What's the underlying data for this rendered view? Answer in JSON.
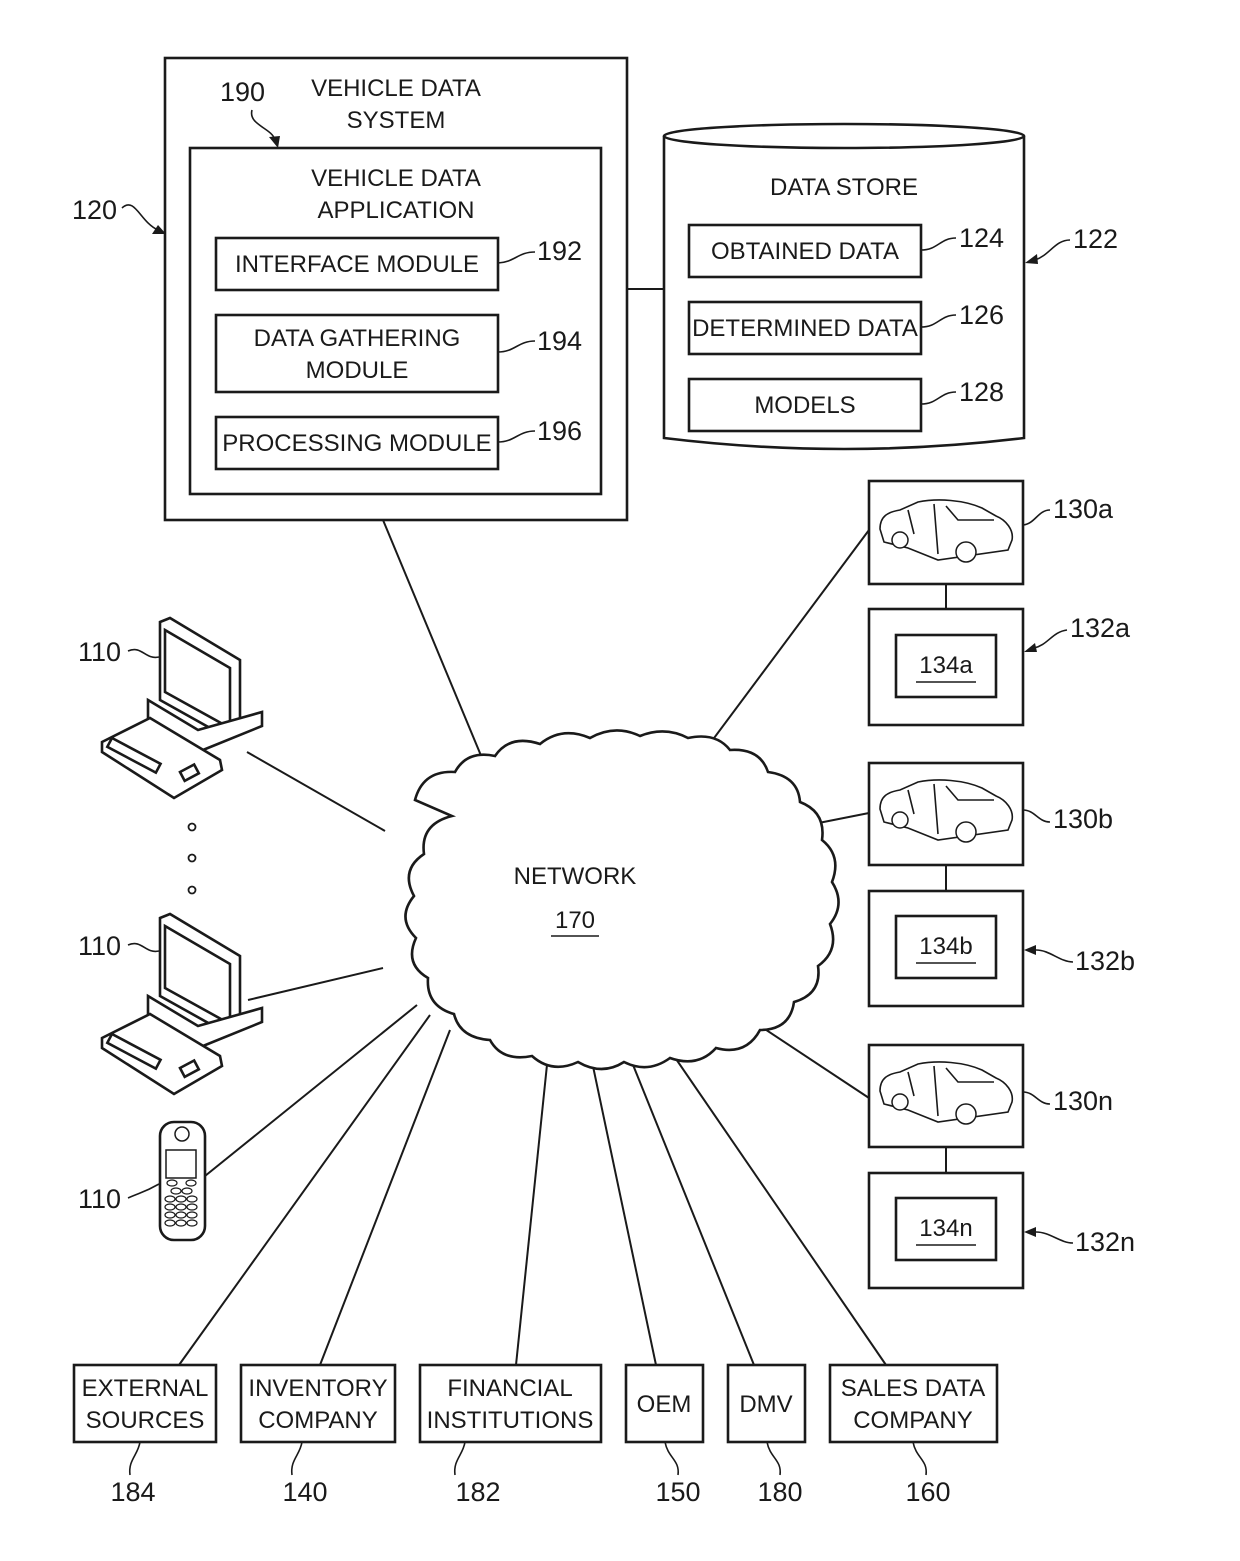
{
  "figure": {
    "vehicle_data_system": {
      "ref": "120",
      "title_line1": "VEHICLE DATA",
      "title_line2": "SYSTEM",
      "application": {
        "ref": "190",
        "title_line1": "VEHICLE DATA",
        "title_line2": "APPLICATION",
        "modules": [
          {
            "ref": "192",
            "line1": "INTERFACE MODULE",
            "line2": ""
          },
          {
            "ref": "194",
            "line1": "DATA GATHERING",
            "line2": "MODULE"
          },
          {
            "ref": "196",
            "line1": "PROCESSING MODULE",
            "line2": ""
          }
        ]
      }
    },
    "data_store": {
      "ref": "122",
      "title": "DATA STORE",
      "items": [
        {
          "ref": "124",
          "label": "OBTAINED DATA"
        },
        {
          "ref": "126",
          "label": "DETERMINED DATA"
        },
        {
          "ref": "128",
          "label": "MODELS"
        }
      ]
    },
    "network": {
      "label": "NETWORK",
      "ref": "170"
    },
    "user_devices": [
      {
        "ref": "110",
        "type": "desktop-computer"
      },
      {
        "ref": "110",
        "type": "desktop-computer"
      },
      {
        "ref": "110",
        "type": "mobile-phone"
      }
    ],
    "vehicles": [
      {
        "vehicle_ref": "130a",
        "device_ref": "132a",
        "component_ref": "134a"
      },
      {
        "vehicle_ref": "130b",
        "device_ref": "132b",
        "component_ref": "134b"
      },
      {
        "vehicle_ref": "130n",
        "device_ref": "132n",
        "component_ref": "134n"
      }
    ],
    "entities": [
      {
        "ref": "184",
        "line1": "EXTERNAL",
        "line2": "SOURCES"
      },
      {
        "ref": "140",
        "line1": "INVENTORY",
        "line2": "COMPANY"
      },
      {
        "ref": "182",
        "line1": "FINANCIAL",
        "line2": "INSTITUTIONS"
      },
      {
        "ref": "150",
        "line1": "OEM",
        "line2": ""
      },
      {
        "ref": "180",
        "line1": "DMV",
        "line2": ""
      },
      {
        "ref": "160",
        "line1": "SALES DATA",
        "line2": "COMPANY"
      }
    ]
  }
}
